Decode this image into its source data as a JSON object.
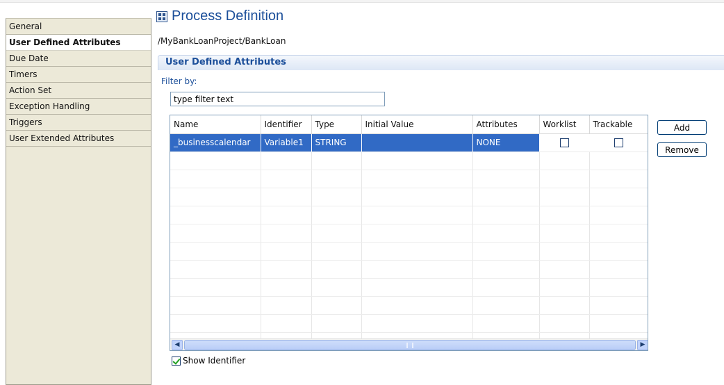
{
  "tabs": [
    {
      "label": "General"
    },
    {
      "label": "User Defined Attributes",
      "selected": true
    },
    {
      "label": "Due Date"
    },
    {
      "label": "Timers"
    },
    {
      "label": "Action Set"
    },
    {
      "label": "Exception Handling"
    },
    {
      "label": "Triggers"
    },
    {
      "label": "User Extended Attributes"
    }
  ],
  "header": {
    "title": "Process Definition",
    "path": "/MyBankLoanProject/BankLoan",
    "icon": "process-definition-icon"
  },
  "section": {
    "title": "User Defined Attributes"
  },
  "filter": {
    "label": "Filter by:",
    "value": "type filter text"
  },
  "table": {
    "columns": [
      "Name",
      "Identifier",
      "Type",
      "Initial Value",
      "Attributes",
      "Worklist",
      "Trackable"
    ],
    "rows": [
      {
        "name": "_businesscalendar",
        "identifier": "Variable1",
        "type": "STRING",
        "initial_value": "",
        "attributes": "NONE",
        "worklist": false,
        "trackable": false,
        "selected": true
      }
    ]
  },
  "buttons": {
    "add": "Add",
    "remove": "Remove"
  },
  "show_identifier": {
    "label": "Show Identifier",
    "checked": true
  },
  "colors": {
    "title": "#1c4f9a",
    "selection": "#316ac5",
    "sidebar_bg": "#ece9d8"
  }
}
